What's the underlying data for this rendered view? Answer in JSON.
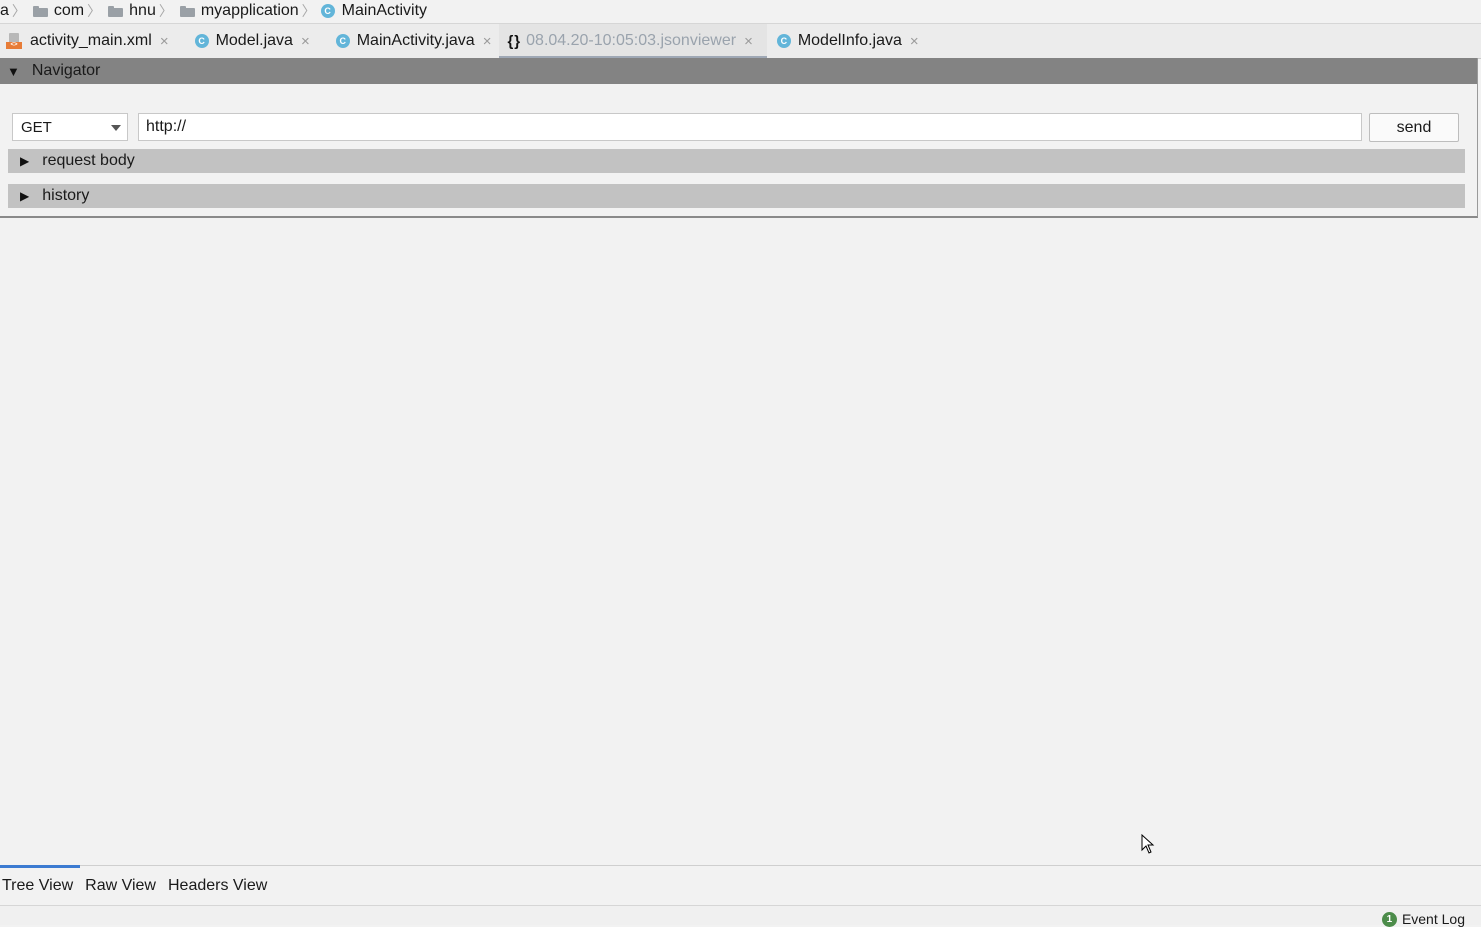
{
  "breadcrumb": {
    "items": [
      {
        "label": "a",
        "icon": "none"
      },
      {
        "label": "com",
        "icon": "folder-icon"
      },
      {
        "label": "hnu",
        "icon": "folder-icon"
      },
      {
        "label": "myapplication",
        "icon": "folder-icon"
      },
      {
        "label": "MainActivity",
        "icon": "class-icon"
      }
    ]
  },
  "tabs": [
    {
      "label": "activity_main.xml",
      "icon": "xml-file-icon",
      "close": "×"
    },
    {
      "label": "Model.java",
      "icon": "class-icon",
      "close": "×"
    },
    {
      "label": "MainActivity.java",
      "icon": "class-icon",
      "close": "×"
    },
    {
      "label": "08.04.20-10:05:03.jsonviewer",
      "icon": "json-icon",
      "close": "×",
      "active": true
    },
    {
      "label": "ModelInfo.java",
      "icon": "class-icon",
      "close": "×"
    }
  ],
  "icons": {
    "class_letter": "C",
    "json": "{}",
    "xml": "<>"
  },
  "navigator": {
    "title": "Navigator",
    "method": "GET",
    "url": "http://",
    "send_label": "send",
    "sections": [
      "request body",
      "history"
    ]
  },
  "bottom_tabs": [
    "Tree View",
    "Raw View",
    "Headers View"
  ],
  "status": {
    "event_count": "1",
    "event_log_label": "Event Log"
  },
  "colors": {
    "accent": "#3c7bd1",
    "class_icon": "#62b5d9",
    "nav_header": "#838383",
    "section": "#c2c2c2"
  }
}
